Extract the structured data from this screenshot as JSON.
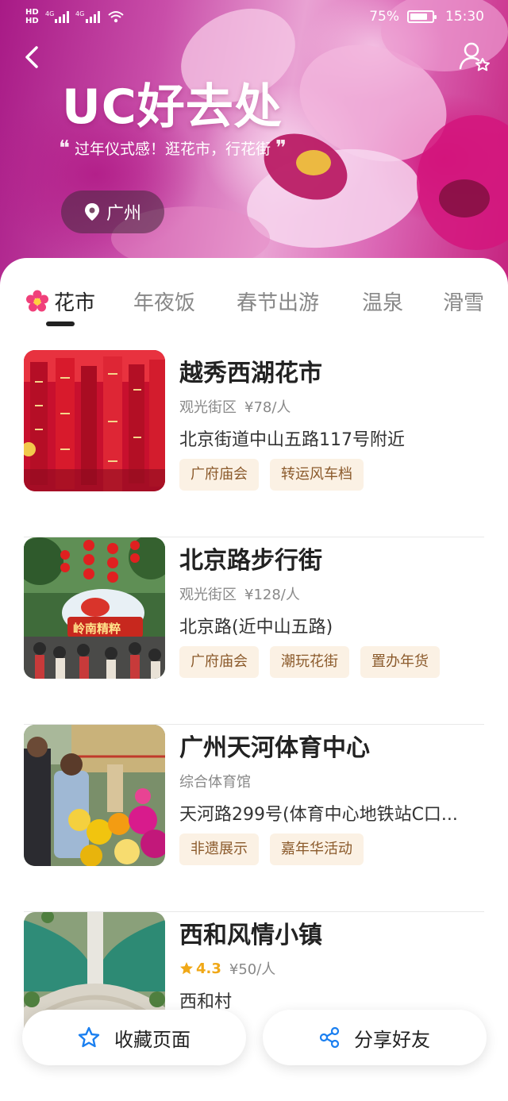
{
  "status_bar": {
    "left_indicators": [
      "HD",
      "4G",
      "4G"
    ],
    "battery": "75%",
    "time": "15:30"
  },
  "hero": {
    "title": "UC好去处",
    "subtitle": "过年仪式感！逛花市，行花街",
    "location": "广州",
    "icons": [
      "back-icon",
      "user-star-icon",
      "location-pin-icon"
    ]
  },
  "tabs": [
    {
      "label": "花市",
      "active": true,
      "icon": "flower-icon"
    },
    {
      "label": "年夜饭"
    },
    {
      "label": "春节出游"
    },
    {
      "label": "温泉"
    },
    {
      "label": "滑雪"
    }
  ],
  "places": [
    {
      "name": "越秀西湖花市",
      "category": "观光街区",
      "price": "¥78/人",
      "address": "北京街道中山五路117号附近",
      "tags": [
        "广府庙会",
        "转运风车档"
      ]
    },
    {
      "name": "北京路步行街",
      "category": "观光街区",
      "price": "¥128/人",
      "address": "北京路(近中山五路)",
      "tags": [
        "广府庙会",
        "潮玩花街",
        "置办年货"
      ],
      "image_text": "岭南精粹"
    },
    {
      "name": "广州天河体育中心",
      "category": "综合体育馆",
      "price": "",
      "address": "天河路299号(体育中心地铁站C口...",
      "tags": [
        "非遗展示",
        "嘉年华活动"
      ]
    },
    {
      "name": "西和风情小镇",
      "rating": "4.3",
      "price": "¥50/人",
      "address": "西和村",
      "tags": []
    }
  ],
  "actions": {
    "favorite": "收藏页面",
    "share": "分享好友"
  },
  "colors": {
    "hero_magenta": "#c94ea9",
    "tag_bg": "#fbf1e4",
    "tag_text": "#8b5a2b",
    "rating": "#f0a817",
    "action_icon": "#1a7ff0"
  }
}
